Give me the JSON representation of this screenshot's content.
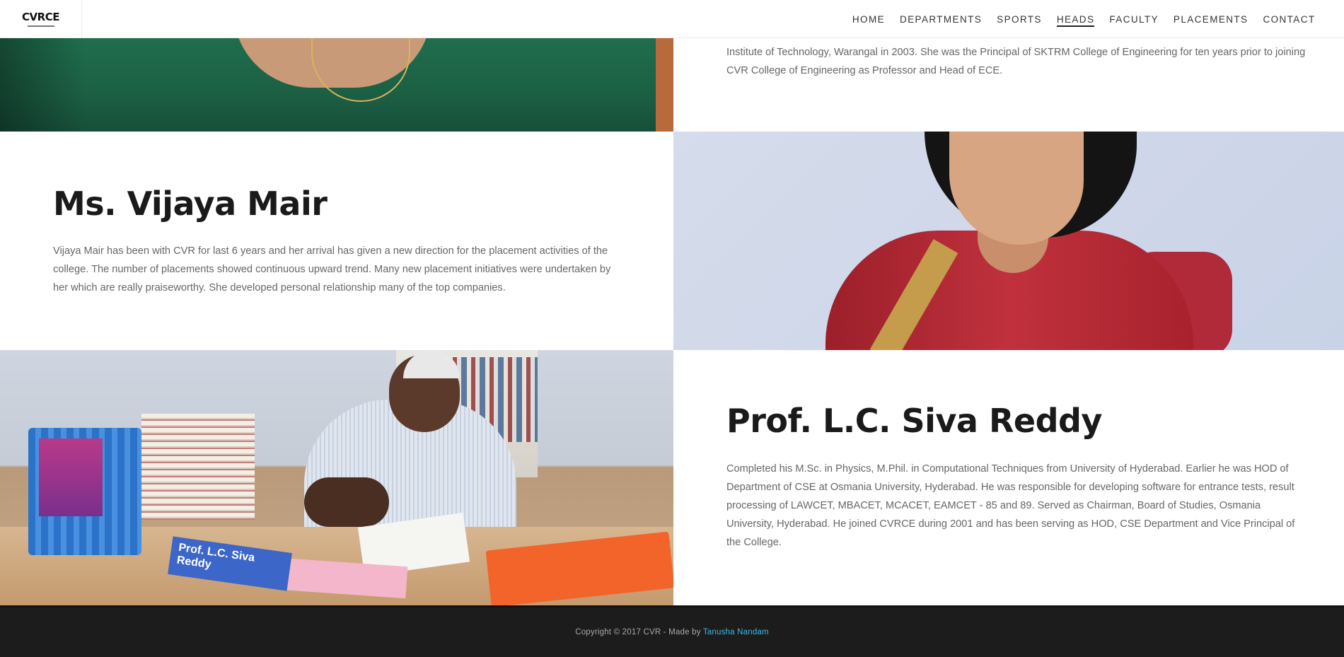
{
  "nav": {
    "logo": "CVRCE",
    "links": [
      {
        "label": "HOME",
        "active": false
      },
      {
        "label": "DEPARTMENTS",
        "active": false
      },
      {
        "label": "SPORTS",
        "active": false
      },
      {
        "label": "HEADS",
        "active": true
      },
      {
        "label": "FACULTY",
        "active": false
      },
      {
        "label": "PLACEMENTS",
        "active": false
      },
      {
        "label": "CONTACT",
        "active": false
      }
    ]
  },
  "row1": {
    "desc": "Institute of Technology, Warangal in 2003. She was the Principal of SKTRM College of Engineering for ten years prior to joining CVR College of Engineering as Professor and Head of ECE."
  },
  "row2": {
    "name": "Ms. Vijaya Mair",
    "desc": "Vijaya Mair has been with CVR for last 6 years and her arrival has given a new direction for the placement activities of the college. The number of placements showed continuous upward trend. Many new placement initiatives were undertaken by her which are really praiseworthy. She developed personal relationship many of the top companies."
  },
  "row3": {
    "name": "Prof. L.C. Siva Reddy",
    "desc": "Completed his M.Sc. in Physics, M.Phil. in Computational Techniques from University of Hyderabad. Earlier he was HOD of Department of CSE at Osmania University, Hyderabad. He was responsible for developing software for entrance tests, result processing of LAWCET, MBACET, MCACET, EAMCET - 85 and 89. Served as Chairman, Board of Studies, Osmania University, Hyderabad. He joined CVRCE during 2001 and has been serving as HOD, CSE Department and Vice Principal of the College.",
    "nameplate": "Prof. L.C. Siva Reddy"
  },
  "footer": {
    "copyright": "Copyright © 2017 CVR - Made by ",
    "author": "Tanusha Nandam"
  },
  "colors": {
    "footer_bg": "#1c1c1c",
    "author_link": "#40b6e8"
  }
}
